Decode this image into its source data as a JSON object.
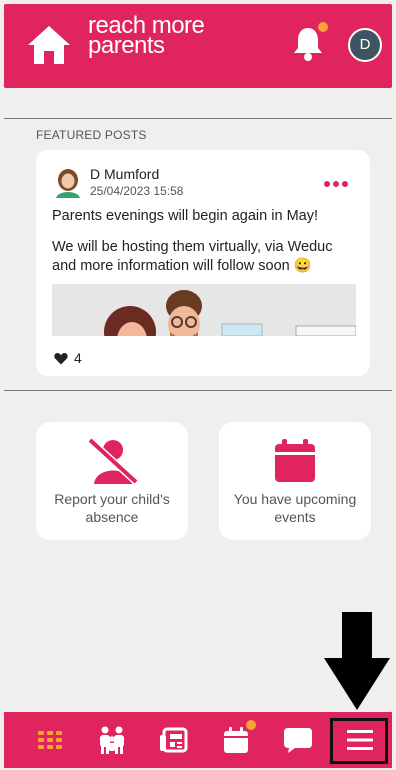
{
  "header": {
    "logo_line1": "reach more",
    "logo_line2": "parents",
    "avatar_initial": "D"
  },
  "featured": {
    "section_label": "FEATURED POSTS",
    "post": {
      "author": "D Mumford",
      "date": "25/04/2023 15:58",
      "text1": "Parents evenings will begin again in May!",
      "text2": "We will be hosting them virtually, via Weduc and more information will follow soon 😀",
      "like_count": "4"
    }
  },
  "tiles": {
    "absence_label": "Report your child's absence",
    "events_label": "You have upcoming events"
  },
  "bottom_nav": {
    "items": [
      "apps-icon",
      "family-icon",
      "news-icon",
      "calendar-icon",
      "chat-icon",
      "menu-icon"
    ]
  },
  "colors": {
    "brand": "#e0245e",
    "badge": "#f7a234",
    "avatar_bg": "#3e5463"
  }
}
